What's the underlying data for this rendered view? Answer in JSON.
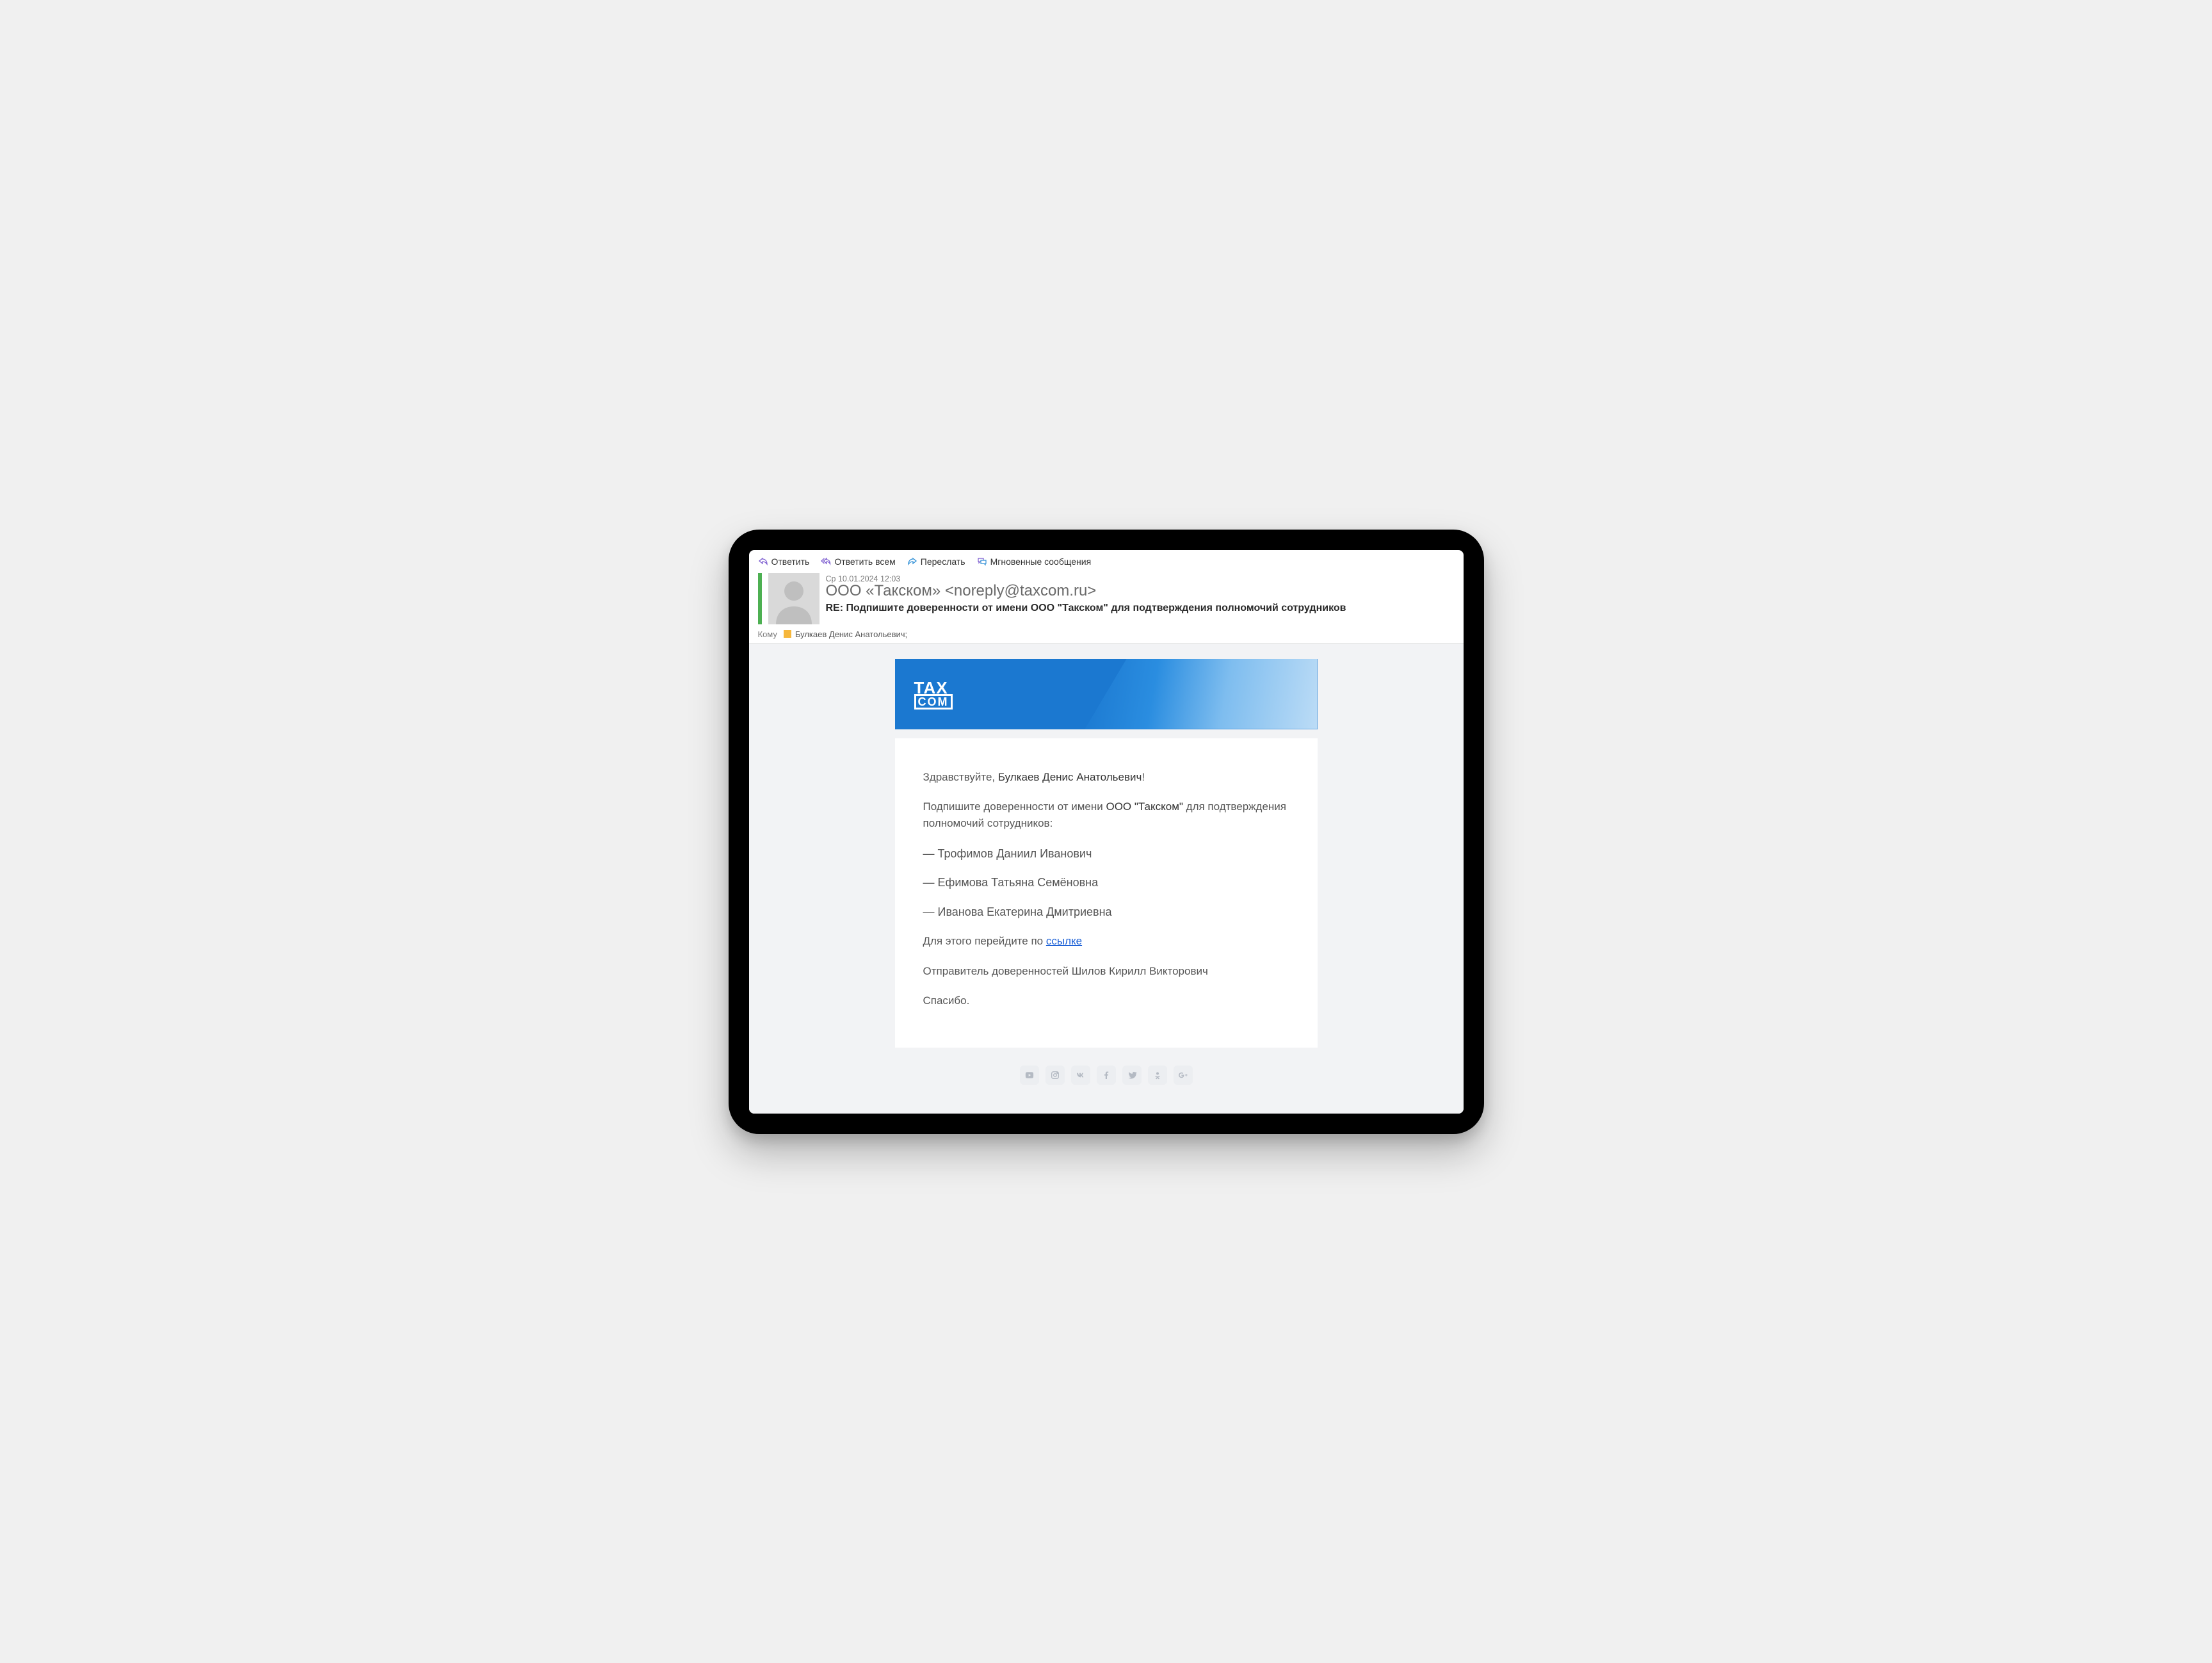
{
  "toolbar": {
    "reply": "Ответить",
    "reply_all": "Ответить всем",
    "forward": "Переслать",
    "im": "Мгновенные сообщения"
  },
  "header": {
    "date": "Ср 10.01.2024 12:03",
    "from": "ООО «Такском» <noreply@taxcom.ru>",
    "subject": "RE: Подпишите доверенности от имени ООО \"Такском\" для подтверждения полномочий сотрудников"
  },
  "to": {
    "label": "Кому",
    "recipient": "Булкаев Денис Анатольевич;"
  },
  "brand": {
    "line1": "TAX",
    "line2": "COM"
  },
  "email": {
    "greeting_prefix": "Здравствуйте, ",
    "greeting_name": "Булкаев Денис Анатольевич",
    "greeting_suffix": "!",
    "intro_a": "Подпишите доверенности от имени ",
    "intro_company": "ООО \"Такском\"",
    "intro_b": " для подтверждения полномочий сотрудников:",
    "employees": [
      "— Трофимов Даниил Иванович",
      "— Ефимова Татьяна Семёновна",
      "— Иванова Екатерина Дмитриевна"
    ],
    "cta_prefix": "Для этого перейдите по ",
    "cta_link": "ссылке",
    "sender_line": "Отправитель доверенностей Шилов Кирилл Викторович",
    "thanks": "Спасибо."
  },
  "social": {
    "items": [
      "youtube",
      "instagram",
      "vk",
      "facebook",
      "twitter",
      "ok",
      "gplus"
    ]
  }
}
